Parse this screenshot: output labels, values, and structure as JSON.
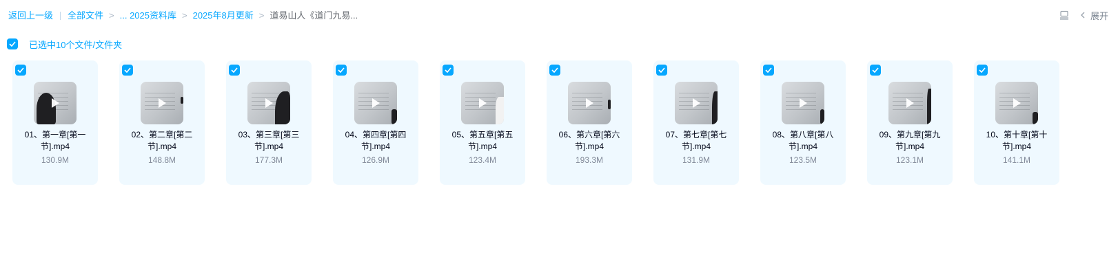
{
  "breadcrumb": {
    "back": "返回上一级",
    "all_files": "全部文件",
    "items": [
      "... 2025资料库",
      "2025年8月更新"
    ],
    "current": "道易山人《道门九易..."
  },
  "toolbar": {
    "expand_label": "展开",
    "icons": [
      "list-view-icon",
      "chevron-left-icon"
    ]
  },
  "selection": {
    "text": "已选中10个文件/文件夹",
    "checked": true
  },
  "colors": {
    "accent": "#06a7ff",
    "card_bg": "#eff9ff",
    "text_primary": "#03081a",
    "text_secondary": "#818999"
  },
  "files": [
    {
      "name": "01、第一章[第一节].mp4",
      "size": "130.9M",
      "selected": true
    },
    {
      "name": "02、第二章[第二节].mp4",
      "size": "148.8M",
      "selected": true
    },
    {
      "name": "03、第三章[第三节].mp4",
      "size": "177.3M",
      "selected": true
    },
    {
      "name": "04、第四章[第四节].mp4",
      "size": "126.9M",
      "selected": true
    },
    {
      "name": "05、第五章[第五节].mp4",
      "size": "123.4M",
      "selected": true
    },
    {
      "name": "06、第六章[第六节].mp4",
      "size": "193.3M",
      "selected": true
    },
    {
      "name": "07、第七章[第七节].mp4",
      "size": "131.9M",
      "selected": true
    },
    {
      "name": "08、第八章[第八节].mp4",
      "size": "123.5M",
      "selected": true
    },
    {
      "name": "09、第九章[第九节].mp4",
      "size": "123.1M",
      "selected": true
    },
    {
      "name": "10、第十章[第十节].mp4",
      "size": "141.1M",
      "selected": true
    }
  ]
}
